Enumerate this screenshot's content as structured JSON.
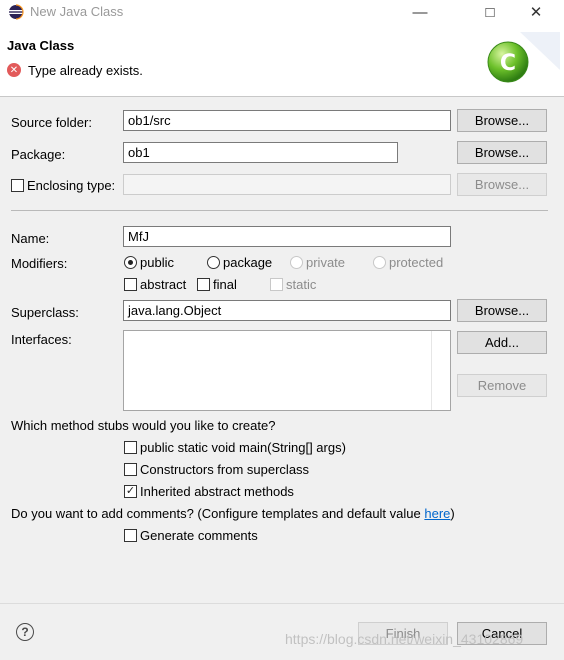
{
  "window": {
    "title": "New Java Class",
    "minimize_glyph": "—",
    "maximize_glyph": "□",
    "close_glyph": "✕"
  },
  "header": {
    "title": "Java Class",
    "error_message": "Type already exists.",
    "logo_letter": "C"
  },
  "form": {
    "source_folder": {
      "label": "Source folder:",
      "value": "ob1/src",
      "browse": "Browse..."
    },
    "package": {
      "label": "Package:",
      "value": "ob1",
      "browse": "Browse..."
    },
    "enclosing_type": {
      "label": "Enclosing type:",
      "value": "",
      "checked": false,
      "browse": "Browse..."
    },
    "name": {
      "label": "Name:",
      "value": "MfJ"
    },
    "modifiers": {
      "label": "Modifiers:",
      "access": [
        {
          "label": "public",
          "checked": true,
          "enabled": true
        },
        {
          "label": "package",
          "checked": false,
          "enabled": true
        },
        {
          "label": "private",
          "checked": false,
          "enabled": false
        },
        {
          "label": "protected",
          "checked": false,
          "enabled": false
        }
      ],
      "other": [
        {
          "label": "abstract",
          "checked": false,
          "enabled": true
        },
        {
          "label": "final",
          "checked": false,
          "enabled": true
        },
        {
          "label": "static",
          "checked": false,
          "enabled": false
        }
      ]
    },
    "superclass": {
      "label": "Superclass:",
      "value": "java.lang.Object",
      "browse": "Browse..."
    },
    "interfaces": {
      "label": "Interfaces:",
      "items": [],
      "add": "Add...",
      "remove": "Remove"
    },
    "stubs": {
      "question": "Which method stubs would you like to create?",
      "options": [
        {
          "label": "public static void main(String[] args)",
          "checked": false
        },
        {
          "label": "Constructors from superclass",
          "checked": false
        },
        {
          "label": "Inherited abstract methods",
          "checked": true
        }
      ]
    },
    "comments": {
      "question": "Do you want to add comments? (Configure templates and default value ",
      "link": "here",
      "suffix": ")",
      "option": {
        "label": "Generate comments",
        "checked": false
      }
    }
  },
  "footer": {
    "help_glyph": "?",
    "finish": "Finish",
    "cancel": "Cancel"
  },
  "watermark": "https://blog.csdn.net/weixin_43102869"
}
